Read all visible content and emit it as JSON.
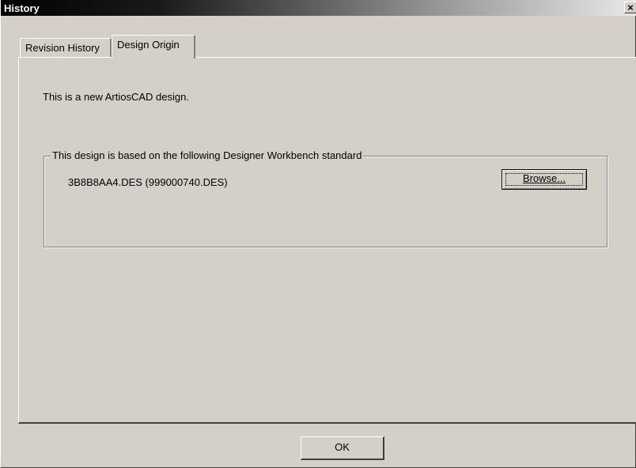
{
  "window": {
    "title": "History",
    "close_label": "×"
  },
  "tabs": [
    {
      "label": "Revision History",
      "active": false
    },
    {
      "label": "Design Origin",
      "active": true
    }
  ],
  "design_origin": {
    "new_design_text": "This is a new ArtiosCAD design.",
    "groupbox_label": "This design is based on the following Designer Workbench standard",
    "design_file": "3B8B8AA4.DES  (999000740.DES)",
    "browse_label": "Browse..."
  },
  "footer": {
    "ok_label": "OK"
  },
  "colors": {
    "face": "#d4d0c8",
    "titlebar_start": "#000000",
    "titlebar_end": "#e8e8e8"
  }
}
